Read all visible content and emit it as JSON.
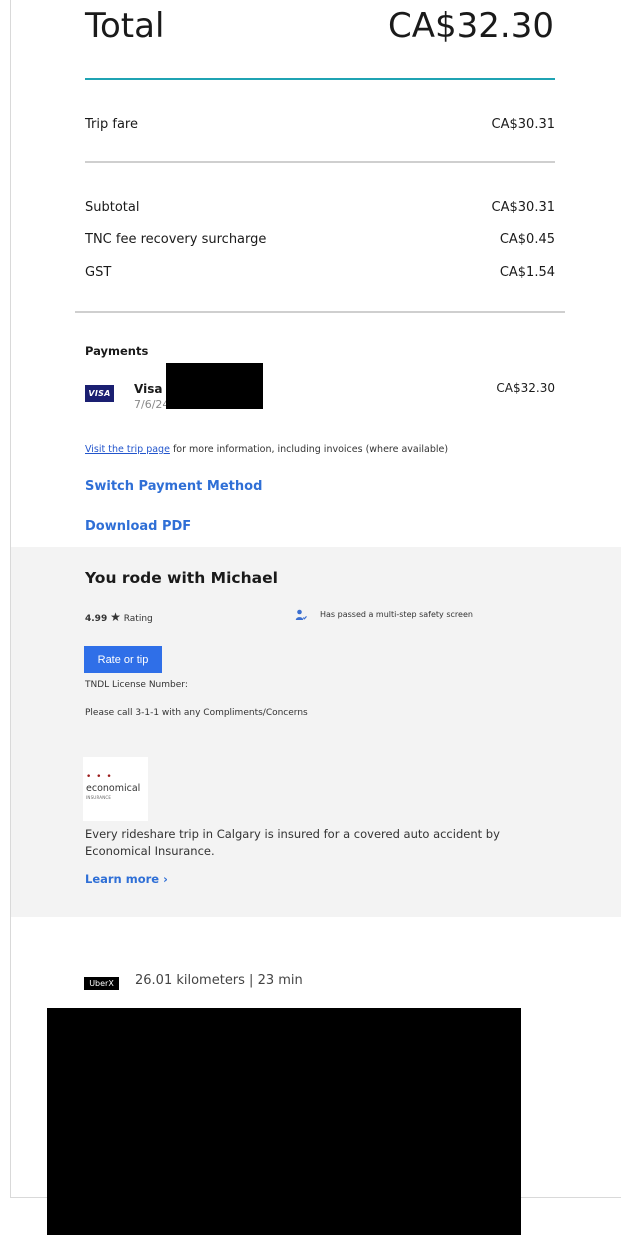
{
  "summary": {
    "total_label": "Total",
    "total_value": "CA$32.30"
  },
  "fare": {
    "trip_fare_label": "Trip fare",
    "trip_fare_value": "CA$30.31"
  },
  "breakdown": {
    "subtotal_label": "Subtotal",
    "subtotal_value": "CA$30.31",
    "tnc_label": "TNC fee recovery surcharge",
    "tnc_value": "CA$0.45",
    "gst_label": "GST",
    "gst_value": "CA$1.54"
  },
  "payments": {
    "title": "Payments",
    "card_logo": "VISA",
    "card_name": "Visa •",
    "date": "7/6/24 7:33 PM",
    "amount": "CA$32.30",
    "trip_page_link": "Visit the trip page",
    "trip_page_rest": " for more information, including invoices (where available)",
    "switch_label": "Switch Payment Method",
    "download_label": "Download PDF"
  },
  "driver": {
    "title": "You rode with Michael",
    "rating_value": "4.99",
    "rating_star": "★",
    "rating_label": "Rating",
    "safety_icon": "person-check-icon",
    "safety_text": "Has passed a multi-step safety screen",
    "rate_button": "Rate or tip",
    "license_text": "TNDL License Number:",
    "call_text": "Please call 3-1-1 with any Compliments/Concerns"
  },
  "insurance": {
    "logo_dots": "• • •",
    "logo_word": "economical",
    "logo_sub": "INSURANCE",
    "text": "Every rideshare trip in Calgary is insured for a covered auto accident by Economical Insurance.",
    "learn_more": "Learn more ›"
  },
  "trip": {
    "badge": "UberX",
    "stats": "26.01 kilometers | 23 min"
  },
  "colors": {
    "accent_teal": "#1fa3b3",
    "link_blue": "#2f6fd6",
    "button_blue": "#2f6fe8",
    "visa_navy": "#1a1f71",
    "panel_gray": "#f3f3f3"
  }
}
